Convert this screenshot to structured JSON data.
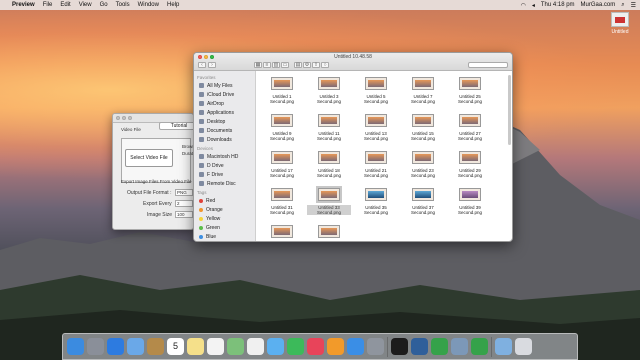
{
  "menubar": {
    "app": "Preview",
    "items": [
      "File",
      "Edit",
      "View",
      "Go",
      "Tools",
      "Window",
      "Help"
    ],
    "clock": "Thu 4:18 pm",
    "site": "MurGaa.com"
  },
  "desktop_icon": {
    "label": "Untitled"
  },
  "tool_window": {
    "tab": "Tutorial",
    "video_file_label": "Video File",
    "select_button": "Select Video File",
    "side_label_1": "Browse",
    "side_label_2": "Duration",
    "section_label": "Export Image Files From Video File",
    "format_label": "Output File Format :",
    "format_value": "PNG",
    "every_label": "Export Every",
    "every_value": "2",
    "size_label": "Image Size",
    "size_value": "100"
  },
  "finder": {
    "title": "Untitled 10.48.58",
    "sidebar": {
      "favorites_header": "Favorites",
      "favorites": [
        "All My Files",
        "iCloud Drive",
        "AirDrop",
        "Applications",
        "Desktop",
        "Documents",
        "Downloads"
      ],
      "devices_header": "Devices",
      "devices": [
        "Macintosh HD",
        "D Drive",
        "F Drive",
        "Remote Disc"
      ],
      "tags_header": "Tags",
      "tags": [
        {
          "label": "Red",
          "color": "#e0423a"
        },
        {
          "label": "Orange",
          "color": "#f2962e"
        },
        {
          "label": "Yellow",
          "color": "#f5d43a"
        },
        {
          "label": "Green",
          "color": "#5bbd4a"
        },
        {
          "label": "Blue",
          "color": "#3d8ee0"
        },
        {
          "label": "Purple",
          "color": "#a659c8"
        }
      ]
    },
    "files": [
      {
        "line1": "Untitled 1",
        "line2": "Second.png",
        "style": "orange"
      },
      {
        "line1": "Untitled 3",
        "line2": "Second.png",
        "style": "orange"
      },
      {
        "line1": "Untitled 5",
        "line2": "Second.png",
        "style": "orange"
      },
      {
        "line1": "Untitled 7",
        "line2": "Second.png",
        "style": "orange"
      },
      {
        "line1": "Untitled 25",
        "line2": "Second.png",
        "style": "orange"
      },
      {
        "line1": "Untitled 9",
        "line2": "Second.png",
        "style": "orange"
      },
      {
        "line1": "Untitled 11",
        "line2": "Second.png",
        "style": "orange"
      },
      {
        "line1": "Untitled 13",
        "line2": "Second.png",
        "style": "orange"
      },
      {
        "line1": "Untitled 15",
        "line2": "Second.png",
        "style": "orange"
      },
      {
        "line1": "Untitled 27",
        "line2": "Second.png",
        "style": "orange"
      },
      {
        "line1": "Untitled 17",
        "line2": "Second.png",
        "style": "orange"
      },
      {
        "line1": "Untitled 18",
        "line2": "Second.png",
        "style": "orange"
      },
      {
        "line1": "Untitled 21",
        "line2": "Second.png",
        "style": "orange"
      },
      {
        "line1": "Untitled 23",
        "line2": "Second.png",
        "style": "orange"
      },
      {
        "line1": "Untitled 29",
        "line2": "Second.png",
        "style": "orange"
      },
      {
        "line1": "Untitled 31",
        "line2": "Second.png",
        "style": "orange"
      },
      {
        "line1": "Untitled 33",
        "line2": "Second.png",
        "style": "orange",
        "selected": true
      },
      {
        "line1": "Untitled 35",
        "line2": "Second.png",
        "style": "blue"
      },
      {
        "line1": "Untitled 37",
        "line2": "Second.png",
        "style": "blue"
      },
      {
        "line1": "Untitled 39",
        "line2": "Second.png",
        "style": "mauve"
      },
      {
        "line1": "",
        "line2": "",
        "style": "orange"
      },
      {
        "line1": "",
        "line2": "",
        "style": "orange"
      }
    ]
  },
  "dock": {
    "apps": [
      {
        "name": "finder-icon",
        "color": "#3b8be0"
      },
      {
        "name": "launchpad-icon",
        "color": "#8a8f99"
      },
      {
        "name": "safari-icon",
        "color": "#2d7be0"
      },
      {
        "name": "mail-icon",
        "color": "#6aa8e8"
      },
      {
        "name": "contacts-icon",
        "color": "#b48a4a"
      },
      {
        "name": "calendar-icon",
        "color": "#ffffff",
        "glyph": "5"
      },
      {
        "name": "notes-icon",
        "color": "#f5e08a"
      },
      {
        "name": "reminders-icon",
        "color": "#f3f3f3"
      },
      {
        "name": "maps-icon",
        "color": "#7cc07a"
      },
      {
        "name": "photos-icon",
        "color": "#f0f0f0"
      },
      {
        "name": "messages-icon",
        "color": "#5bb0f0"
      },
      {
        "name": "facetime-icon",
        "color": "#3cba5a"
      },
      {
        "name": "itunes-icon",
        "color": "#e8445a"
      },
      {
        "name": "ibooks-icon",
        "color": "#f29a2a"
      },
      {
        "name": "app-store-icon",
        "color": "#3a8ee6"
      },
      {
        "name": "system-preferences-icon",
        "color": "#8f959e"
      },
      {
        "name": "terminal-icon",
        "color": "#1c1c1c"
      },
      {
        "name": "quicktime-icon",
        "color": "#2f5f9a"
      },
      {
        "name": "video-tool-icon",
        "color": "#35a24a"
      },
      {
        "name": "preview-icon",
        "color": "#7c98b8"
      },
      {
        "name": "video-tool-2-icon",
        "color": "#35a24a"
      },
      {
        "name": "folder-icon",
        "color": "#7fb0e0"
      },
      {
        "name": "trash-icon",
        "color": "#d9dbe0"
      }
    ]
  }
}
